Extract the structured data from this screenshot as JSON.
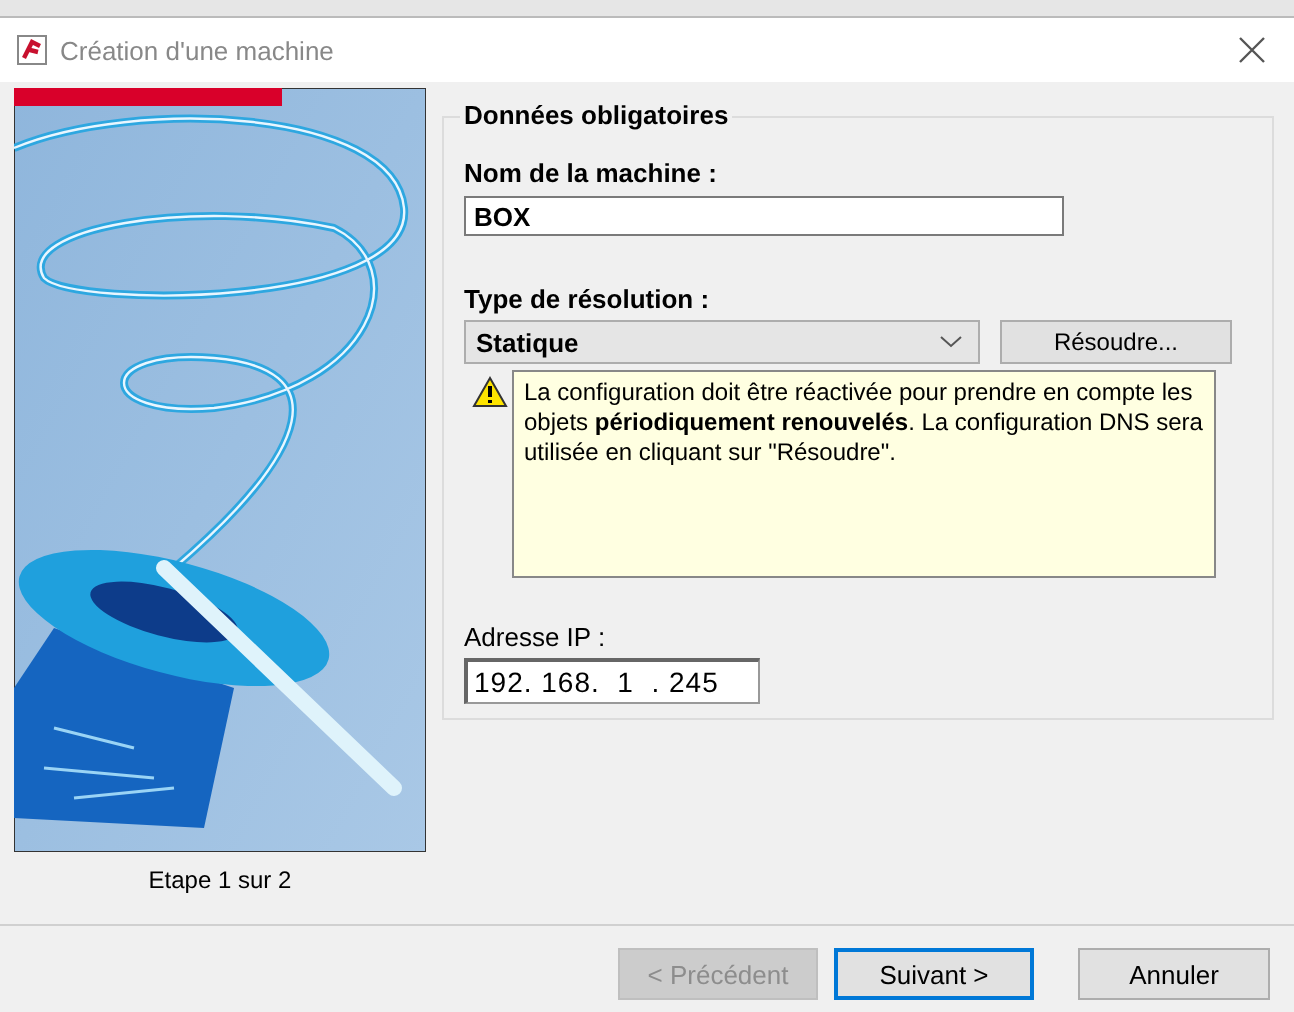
{
  "window": {
    "title": "Création d'une machine"
  },
  "wizard": {
    "step": "Etape 1 sur 2"
  },
  "group": {
    "legend": "Données obligatoires",
    "name_field": {
      "label": "Nom de la machine :",
      "value": "BOX"
    },
    "resolution": {
      "label": "Type de résolution :",
      "value": "Statique",
      "button": "Résoudre..."
    },
    "warning": "La configuration doit être réactivée pour prendre en compte les objets **périodiquement renouvelés**. La configuration DNS sera utilisée en cliquant sur \"Résoudre\".",
    "ip_field": {
      "label": "Adresse IP :",
      "value": "192. 168.  1  . 245"
    }
  },
  "buttons": [
    {
      "label": "< Précédent",
      "disabled": true,
      "default": false
    },
    {
      "label": "Suivant >",
      "disabled": false,
      "default": true
    },
    {
      "label": "Annuler",
      "disabled": false,
      "default": false
    }
  ]
}
